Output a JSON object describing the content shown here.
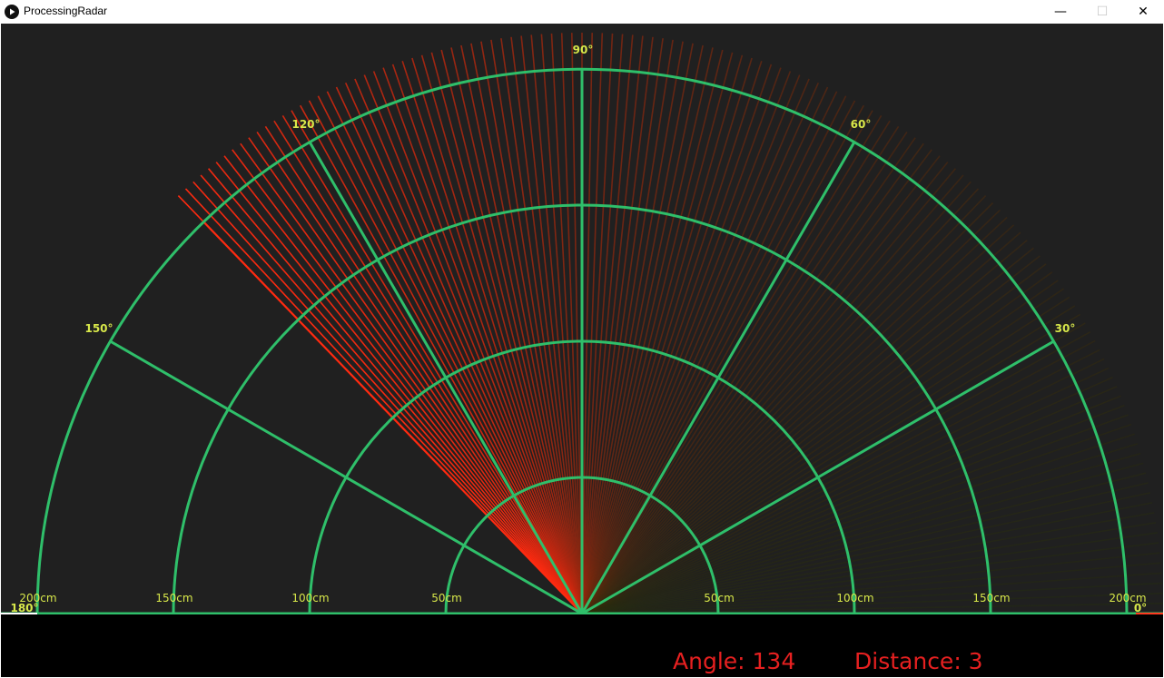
{
  "window": {
    "title": "ProcessingRadar",
    "minimize_symbol": "—",
    "maximize_symbol": "☐",
    "close_symbol": "✕"
  },
  "radar": {
    "angle_labels": [
      {
        "text": "0°",
        "angle": 0
      },
      {
        "text": "30°",
        "angle": 30
      },
      {
        "text": "60°",
        "angle": 60
      },
      {
        "text": "90°",
        "angle": 90
      },
      {
        "text": "120°",
        "angle": 120
      },
      {
        "text": "150°",
        "angle": 150
      },
      {
        "text": "180°",
        "angle": 180
      }
    ],
    "range_labels_left": [
      "200cm",
      "150cm",
      "100cm",
      "50cm"
    ],
    "range_labels_right": [
      "50cm",
      "100cm",
      "150cm",
      "200cm"
    ],
    "grid_color": "#2fbf6a",
    "label_color": "#d8e84a",
    "sweep_color": "#ff2a10",
    "current_angle": 134,
    "sweep_trail_degrees": 134
  },
  "readouts": {
    "angle_text": "Angle: 134",
    "distance_text": "Distance: 3"
  }
}
